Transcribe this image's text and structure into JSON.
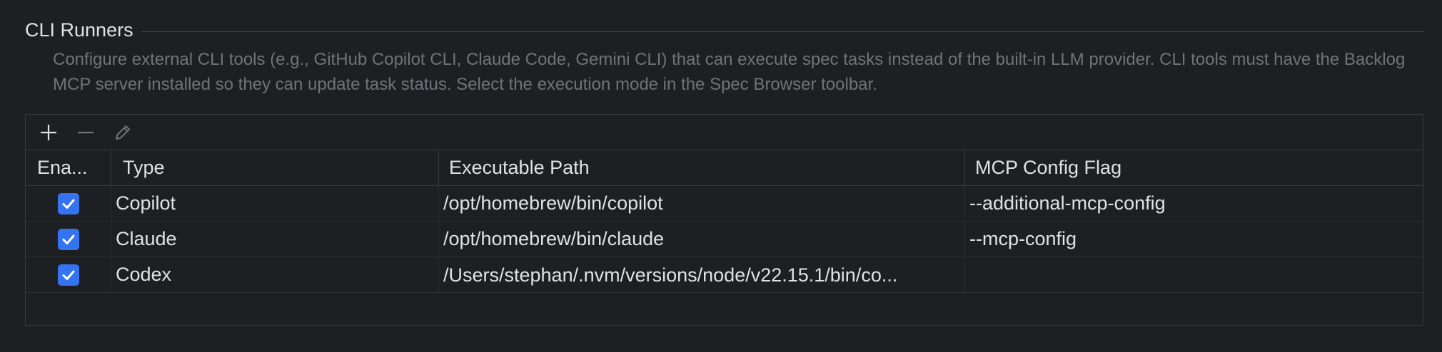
{
  "section": {
    "title": "CLI Runners",
    "description": "Configure external CLI tools (e.g., GitHub Copilot CLI, Claude Code, Gemini CLI) that can execute spec tasks instead of the built-in LLM provider. CLI tools must have the Backlog MCP server installed so they can update task status. Select the execution mode in the Spec Browser toolbar."
  },
  "toolbar": {
    "add_icon": "plus-icon",
    "remove_icon": "minus-icon",
    "edit_icon": "pencil-icon"
  },
  "table": {
    "columns": [
      "Ena...",
      "Type",
      "Executable Path",
      "MCP Config Flag"
    ],
    "rows": [
      {
        "enabled": true,
        "type": "Copilot",
        "path": "/opt/homebrew/bin/copilot",
        "flag": "--additional-mcp-config"
      },
      {
        "enabled": true,
        "type": "Claude",
        "path": "/opt/homebrew/bin/claude",
        "flag": "--mcp-config"
      },
      {
        "enabled": true,
        "type": "Codex",
        "path": "/Users/stephan/.nvm/versions/node/v22.15.1/bin/co...",
        "flag": ""
      }
    ]
  },
  "colors": {
    "background": "#1e1f22",
    "checkbox": "#3574f0",
    "muted_text": "#6f737a"
  }
}
